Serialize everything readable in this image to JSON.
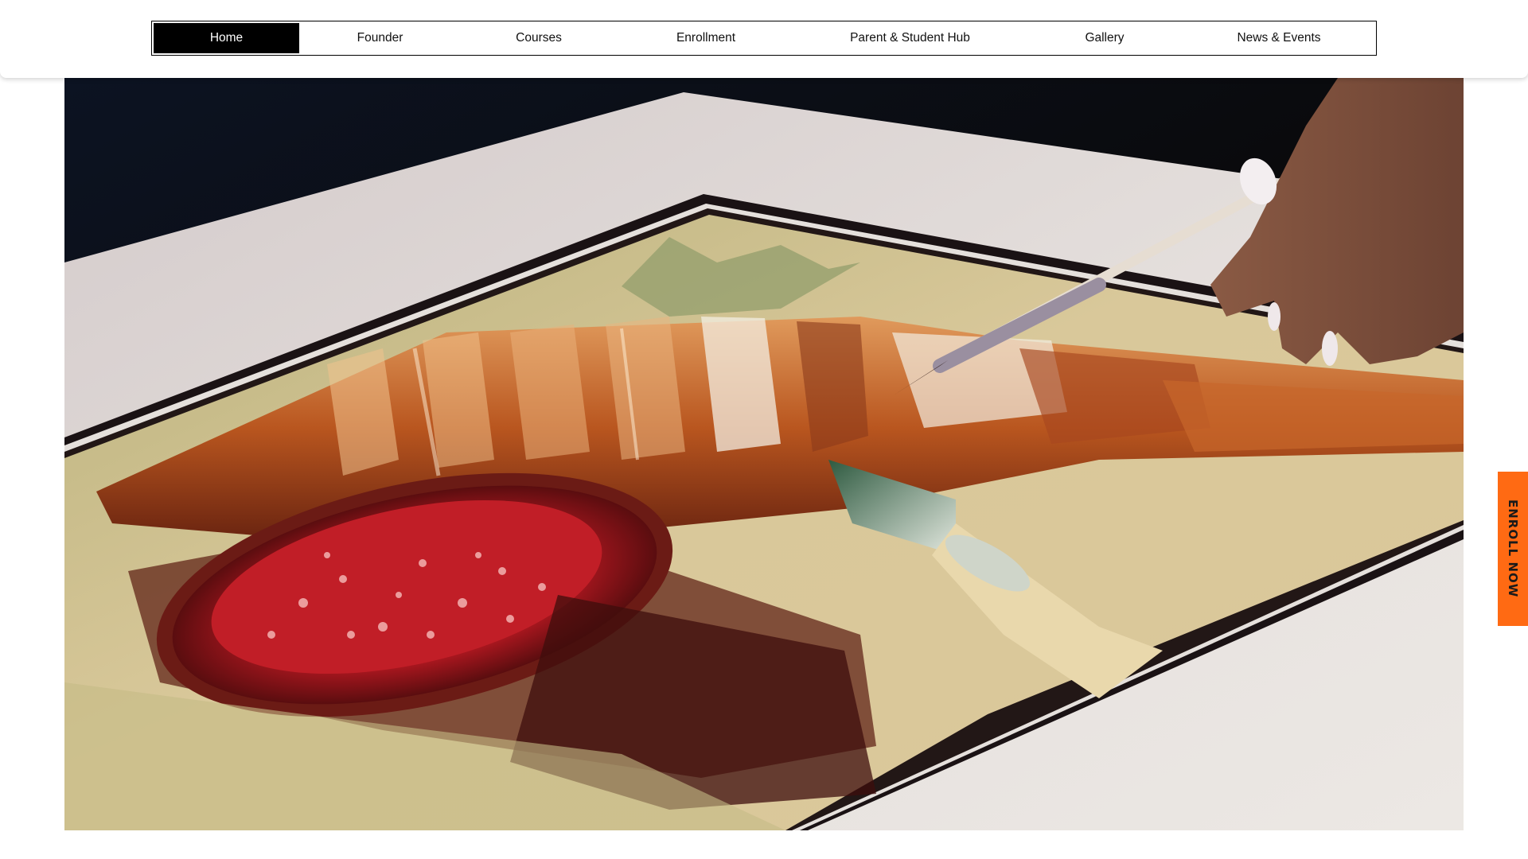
{
  "nav": {
    "items": [
      {
        "label": "Home",
        "active": true
      },
      {
        "label": "Founder",
        "active": false
      },
      {
        "label": "Courses",
        "active": false
      },
      {
        "label": "Enrollment",
        "active": false
      },
      {
        "label": "Parent & Student Hub",
        "active": false
      },
      {
        "label": "Gallery",
        "active": false
      },
      {
        "label": "News & Events",
        "active": false
      }
    ]
  },
  "hero": {
    "image_subject": "watercolor painting of sliced bread and jam being painted with a brush"
  },
  "enroll_tab": {
    "label": "ENROLL NOW",
    "color": "#ff6a13"
  },
  "colors": {
    "nav_active_bg": "#000000",
    "nav_active_text": "#ffffff",
    "accent": "#ff6a13"
  }
}
